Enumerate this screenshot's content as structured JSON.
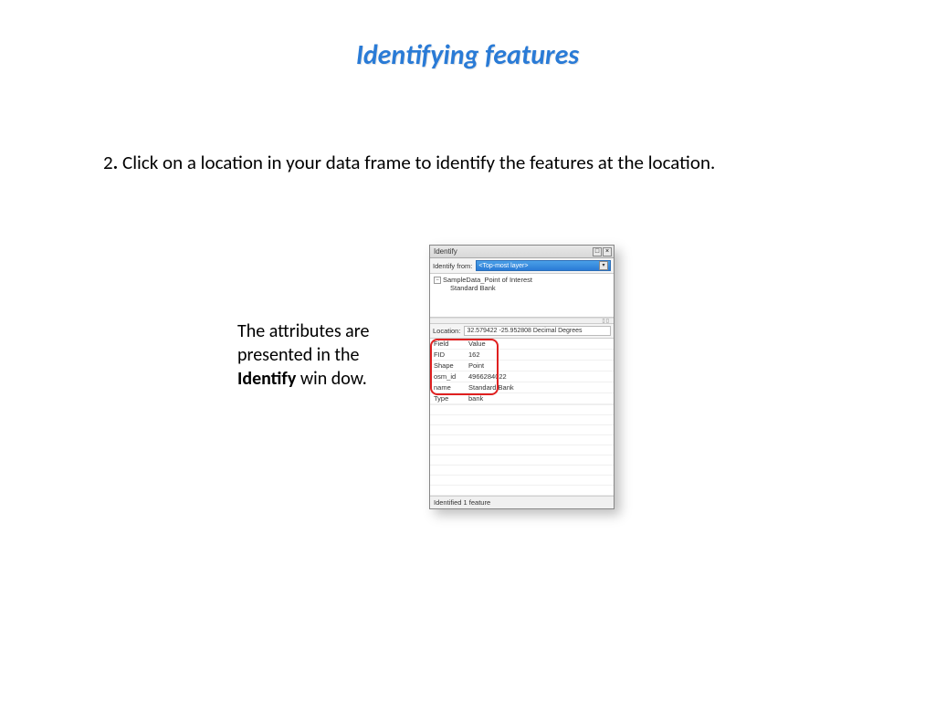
{
  "title": "Identifying features",
  "instruction": {
    "step": "2",
    "text": "Click on a location in your data frame to identify the features at the location."
  },
  "caption": {
    "prefix": "The attributes are presented in the ",
    "bold": "Identify",
    "suffix": " win dow."
  },
  "identify_window": {
    "title": "Identify",
    "identify_from_label": "Identify from:",
    "identify_from_value": "<Top-most layer>",
    "tree": {
      "parent": "SampleData_Point of Interest",
      "child": "Standard Bank"
    },
    "location_label": "Location:",
    "location_value": "32.579422 -25.952808 Decimal Degrees",
    "attributes": {
      "header_field": "Field",
      "header_value": "Value",
      "rows": [
        {
          "field": "FID",
          "value": "162"
        },
        {
          "field": "Shape",
          "value": "Point"
        },
        {
          "field": "osm_id",
          "value": "4966284022"
        },
        {
          "field": "name",
          "value": "Standard Bank"
        },
        {
          "field": "Type",
          "value": "bank"
        }
      ]
    },
    "status": "Identified 1 feature"
  }
}
